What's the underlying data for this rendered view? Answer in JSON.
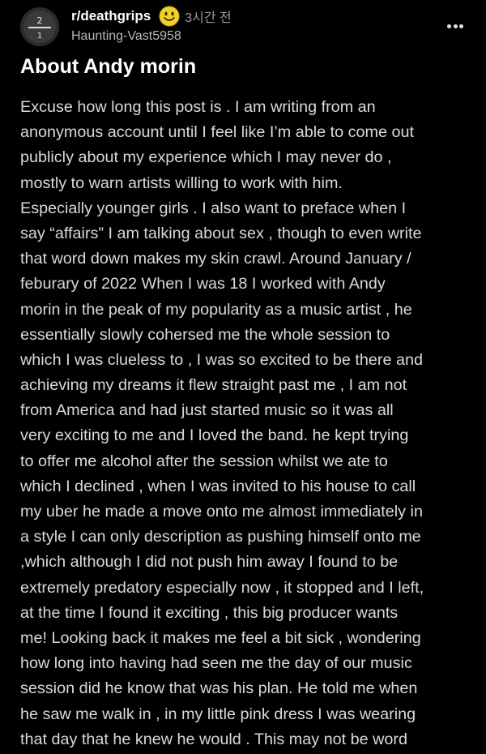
{
  "post": {
    "subreddit": "r/deathgrips",
    "time_ago": "3시간 전",
    "author": "Haunting-Vast5958",
    "title": "About Andy morin",
    "flair_icon": "smiley-face-emoji",
    "more_icon": "more-options-icon",
    "body_lines": [
      "Excuse how long this post is . I am writing from an",
      "anonymous account until I feel like I’m able to come out",
      "publicly about my experience which I may never do ,",
      "mostly to warn artists willing to work with him.",
      "Especially younger girls . I also want to preface when I",
      "say “affairs” I am talking about sex , though to even write",
      "that word down makes my skin crawl. Around January /",
      "feburary of 2022 When I was 18 I worked with Andy",
      "morin in the peak of my popularity as a music artist , he",
      "essentially slowly cohersed me the whole session to",
      "which I was clueless to , I was so excited to be there and",
      "achieving my dreams it flew straight past me , I am not",
      "from America and had just started music so it was all",
      "very exciting to me and I loved the band. he kept trying",
      "to offer me alcohol after the session whilst we ate to",
      "which I declined , when I was invited to his house to call",
      "my uber he made a move onto me almost immediately in",
      "a style I can only description as pushing himself onto me",
      ",which although I did not push him away I found to be",
      "extremely predatory especially now , it stopped and I left,",
      "at the time I found it exciting , this big producer wants",
      "me! Looking back it makes me feel a bit sick , wondering",
      "how long into having had seen me the day of our music",
      "session did he know that was his plan. He told me when",
      "he saw me walk in , in my little pink dress I was wearing",
      "that day that he knew he would . This may not be word"
    ]
  },
  "colors": {
    "background": "#000000",
    "title": "#ffffff",
    "body_text": "#d7dadc",
    "meta_text": "#9a9a9a",
    "emoji_yellow": "#f2d02b"
  }
}
